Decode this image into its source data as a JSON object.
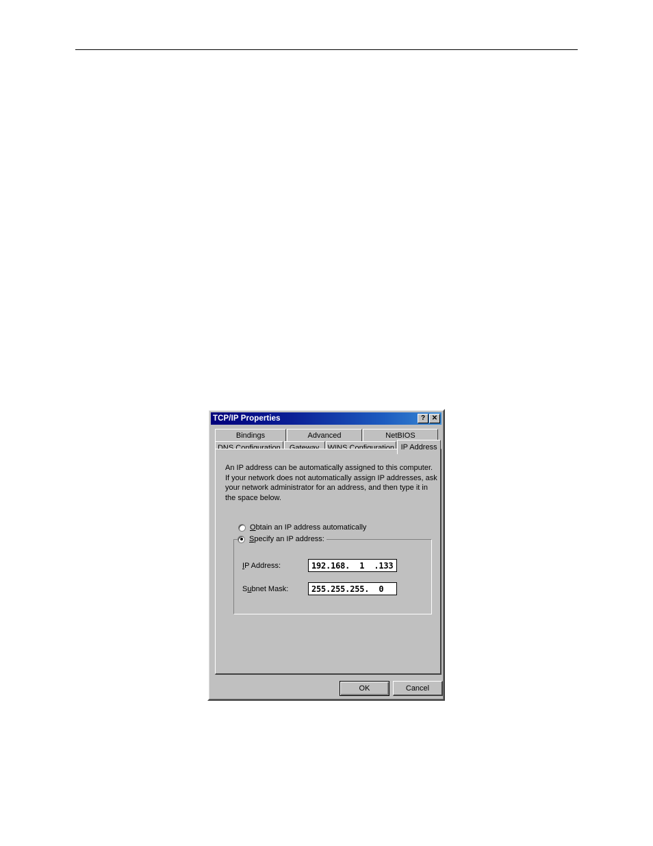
{
  "document": {
    "header_rule": true
  },
  "dialog": {
    "title": "TCP/IP Properties",
    "titlebar_buttons": [
      {
        "name": "help",
        "glyph": "?"
      },
      {
        "name": "close",
        "glyph": "✕"
      }
    ],
    "tabs_row1": [
      {
        "label": "Bindings",
        "active": false
      },
      {
        "label": "Advanced",
        "active": false
      },
      {
        "label": "NetBIOS",
        "active": false
      }
    ],
    "tabs_row2": [
      {
        "label": "DNS Configuration",
        "active": false
      },
      {
        "label": "Gateway",
        "active": false
      },
      {
        "label": "WINS Configuration",
        "active": false
      },
      {
        "label": "IP Address",
        "active": true
      }
    ],
    "description": [
      "An IP address can be automatically assigned to this computer.",
      "If your network does not automatically assign IP addresses, ask",
      "your network administrator for an address, and then type it in",
      "the space below."
    ],
    "radio_obtain": {
      "label_underlined": "O",
      "label_rest": "btain an IP address automatically",
      "checked": false
    },
    "radio_specify": {
      "label_underlined": "S",
      "label_rest": "pecify an IP address:",
      "checked": true
    },
    "fields": [
      {
        "label_underlined": "I",
        "label_rest": "P Address:",
        "value": "192.168.  1  .133"
      },
      {
        "label_pre": "S",
        "label_underlined": "u",
        "label_rest": "bnet Mask:",
        "value": "255.255.255.  0"
      }
    ],
    "buttons": {
      "ok": "OK",
      "cancel": "Cancel"
    },
    "colors": {
      "face": "#c0c0c0",
      "titlebar_start": "#00007b",
      "titlebar_end": "#3a8ad4",
      "field_bg": "#ffffff",
      "text": "#000000"
    }
  }
}
